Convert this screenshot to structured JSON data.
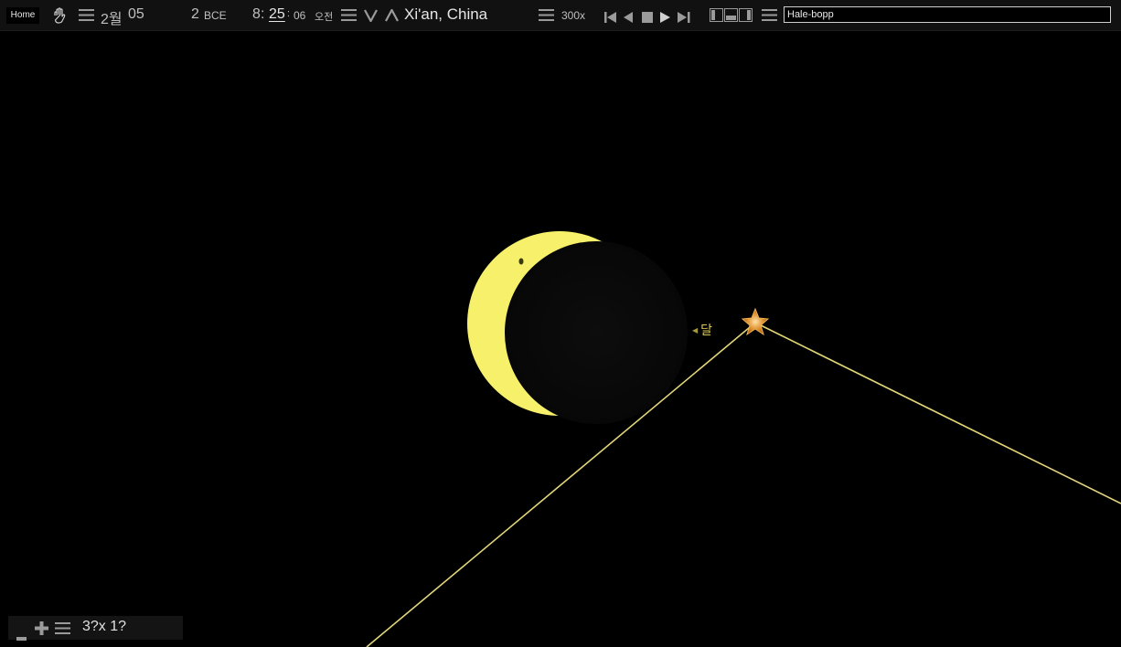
{
  "toolbar": {
    "home_label": "Home",
    "date": {
      "month": "2월",
      "day": "05",
      "year": "2",
      "era": "BCE"
    },
    "time": {
      "hour": "8",
      "minute": "25",
      "second": "06",
      "ampm": "오전"
    },
    "location": "Xi'an, China",
    "speed": "300x",
    "search": {
      "value": "Hale-bopp"
    },
    "icons": {
      "pan": "hand-icon",
      "menu": "hamburger-icon",
      "prev": "chevron-down-icon",
      "next": "chevron-up-icon",
      "skip_back": "skip-to-start-icon",
      "step_back": "step-back-icon",
      "stop": "stop-icon",
      "play": "play-icon",
      "skip_forward": "skip-to-end-icon",
      "layout": "layout-panels-icon"
    }
  },
  "sky": {
    "moon_label": "달",
    "object_marker": "star-marker-icon",
    "colors": {
      "sun": "#f6f06a",
      "moon": "#0a0a0a",
      "track": "#e2d57a",
      "marker": "#d98b2c"
    }
  },
  "zoom": {
    "level": "3?x 1?",
    "icons": {
      "zoom_out": "minus-icon",
      "zoom_in": "plus-icon",
      "menu": "hamburger-icon"
    }
  }
}
